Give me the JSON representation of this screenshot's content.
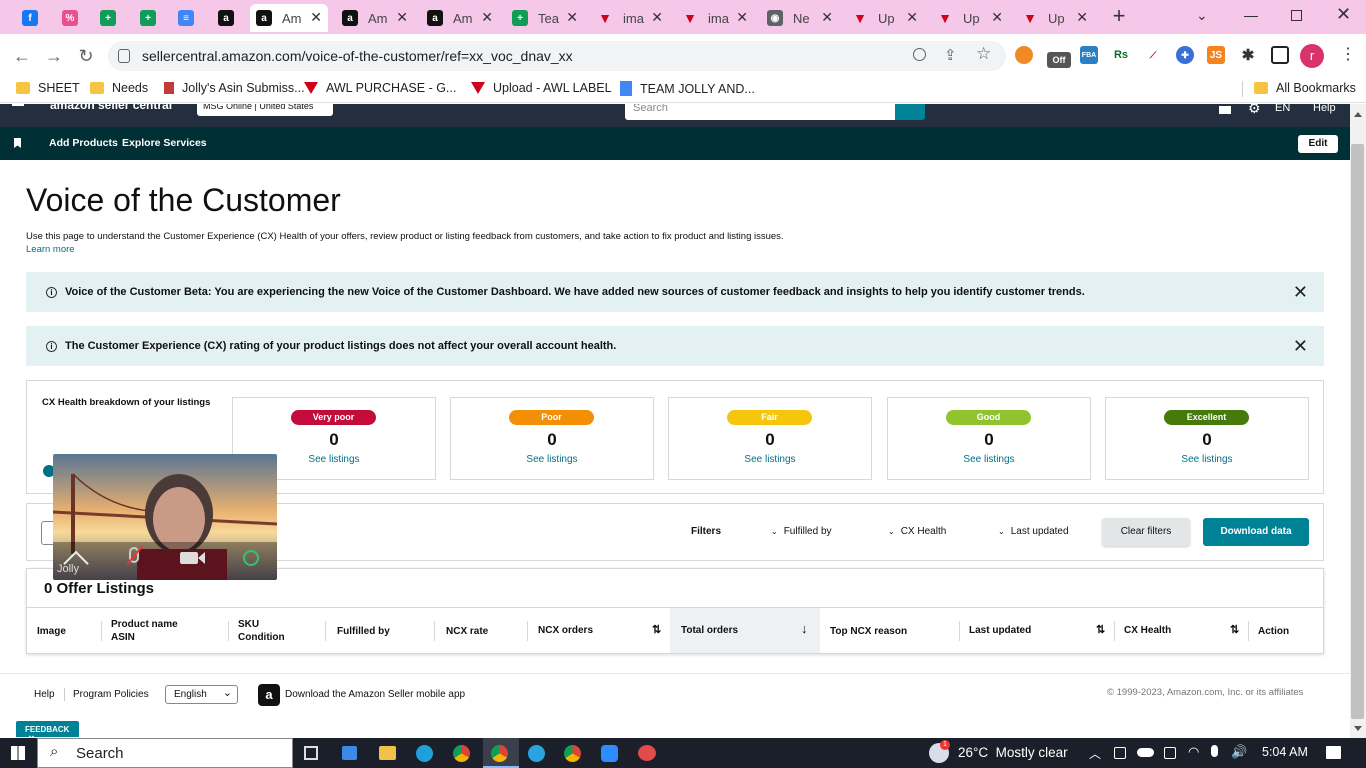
{
  "browser": {
    "tabs": [
      {
        "title": "",
        "icon": "facebook-icon",
        "color": "#1877f2",
        "glyph": "f"
      },
      {
        "title": "",
        "icon": "percent-icon",
        "color": "#e8508f",
        "glyph": "%"
      },
      {
        "title": "",
        "icon": "sheets-icon",
        "color": "#0f9d58",
        "glyph": "+"
      },
      {
        "title": "",
        "icon": "sheets-icon",
        "color": "#0f9d58",
        "glyph": "+"
      },
      {
        "title": "",
        "icon": "docs-icon",
        "color": "#4285f4",
        "glyph": "≡"
      },
      {
        "title": "",
        "icon": "amazon-icon",
        "color": "#111111",
        "glyph": "a"
      },
      {
        "title": "Am",
        "icon": "amazon-icon",
        "color": "#111111",
        "glyph": "a",
        "active": true
      },
      {
        "title": "Am",
        "icon": "amazon-icon",
        "color": "#111111",
        "glyph": "a"
      },
      {
        "title": "Am",
        "icon": "amazon-icon",
        "color": "#111111",
        "glyph": "a"
      },
      {
        "title": "Tea",
        "icon": "sheets-icon",
        "color": "#0f9d58",
        "glyph": "+"
      },
      {
        "title": "ima",
        "icon": "v-logo-icon",
        "color": "#d0021b",
        "glyph": "▼"
      },
      {
        "title": "ima",
        "icon": "v-logo-icon",
        "color": "#d0021b",
        "glyph": "▼"
      },
      {
        "title": "Ne",
        "icon": "chrome-icon",
        "color": "#5f6368",
        "glyph": "◉"
      },
      {
        "title": "Up",
        "icon": "v-logo-icon",
        "color": "#d0021b",
        "glyph": "▼"
      },
      {
        "title": "Up",
        "icon": "v-logo-icon",
        "color": "#d0021b",
        "glyph": "▼"
      },
      {
        "title": "Up",
        "icon": "v-logo-icon",
        "color": "#d0021b",
        "glyph": "▼"
      }
    ],
    "url": "sellercentral.amazon.com/voice-of-the-customer/ref=xx_voc_dnav_xx",
    "bookmarks": [
      {
        "label": "SHEET",
        "icon": "folder-icon"
      },
      {
        "label": "Needs",
        "icon": "folder-icon"
      },
      {
        "label": "Jolly's Asin Submiss...",
        "icon": "bookmark-icon"
      },
      {
        "label": "AWL PURCHASE - G...",
        "icon": "v-logo-icon"
      },
      {
        "label": "Upload - AWL LABEL",
        "icon": "v-logo-icon"
      },
      {
        "label": "TEAM JOLLY AND...",
        "icon": "docs-icon"
      }
    ],
    "all_bookmarks": "All Bookmarks",
    "profile_initial": "r",
    "ext_off": "Off"
  },
  "amazon": {
    "logo": "amazon seller central",
    "store": "MSG Online | United States",
    "search_placeholder": "Search",
    "lang": "EN",
    "help": "Help",
    "nav": [
      "Add Products",
      "Explore Services"
    ],
    "edit": "Edit"
  },
  "page": {
    "title": "Voice of the Customer",
    "desc": "Use this page to understand the Customer Experience (CX) Health of your offers, review product or listing feedback from customers, and take action to fix product and listing issues.",
    "learn_more": "Learn more",
    "banner1": "Voice of the Customer Beta: You are experiencing the new Voice of the Customer Dashboard. We have added new sources of customer feedback and insights to help you identify customer trends.",
    "banner2": "The Customer Experience (CX) rating of your product listings does not affect your overall account health.",
    "cx_label": "CX Health breakdown of your listings",
    "cx_cards": [
      {
        "label": "Very poor",
        "count": "0",
        "link": "See listings",
        "color": "#c40c3c"
      },
      {
        "label": "Poor",
        "count": "0",
        "link": "See listings",
        "color": "#f28f06"
      },
      {
        "label": "Fair",
        "count": "0",
        "link": "See listings",
        "color": "#f6c60c"
      },
      {
        "label": "Good",
        "count": "0",
        "link": "See listings",
        "color": "#8fc42f"
      },
      {
        "label": "Excellent",
        "count": "0",
        "link": "See listings",
        "color": "#467a0a"
      }
    ],
    "filters": {
      "label": "Filters",
      "fulfilled": "Fulfilled by",
      "cx": "CX Health",
      "updated": "Last updated",
      "clear": "Clear filters",
      "download": "Download data"
    },
    "offers_title": "0 Offer Listings",
    "columns": {
      "image": "Image",
      "product": "Product name",
      "asin": "ASIN",
      "sku": "SKU",
      "condition": "Condition",
      "fulfilled": "Fulfilled by",
      "ncx_rate": "NCX rate",
      "ncx_orders": "NCX orders",
      "total_orders": "Total orders",
      "top_reason": "Top NCX reason",
      "last_updated": "Last updated",
      "cx_health": "CX Health",
      "action": "Action"
    }
  },
  "footer": {
    "help": "Help",
    "policies": "Program Policies",
    "language": "English",
    "app": "Download the Amazon Seller mobile app",
    "copyright": "© 1999-2023, Amazon.com, Inc. or its affiliates",
    "feedback": "FEEDBACK"
  },
  "video": {
    "name": "Jolly"
  },
  "taskbar": {
    "search": "Search",
    "weather": "26°C  Mostly clear",
    "time": "5:04 AM",
    "weather_badge": "1"
  }
}
